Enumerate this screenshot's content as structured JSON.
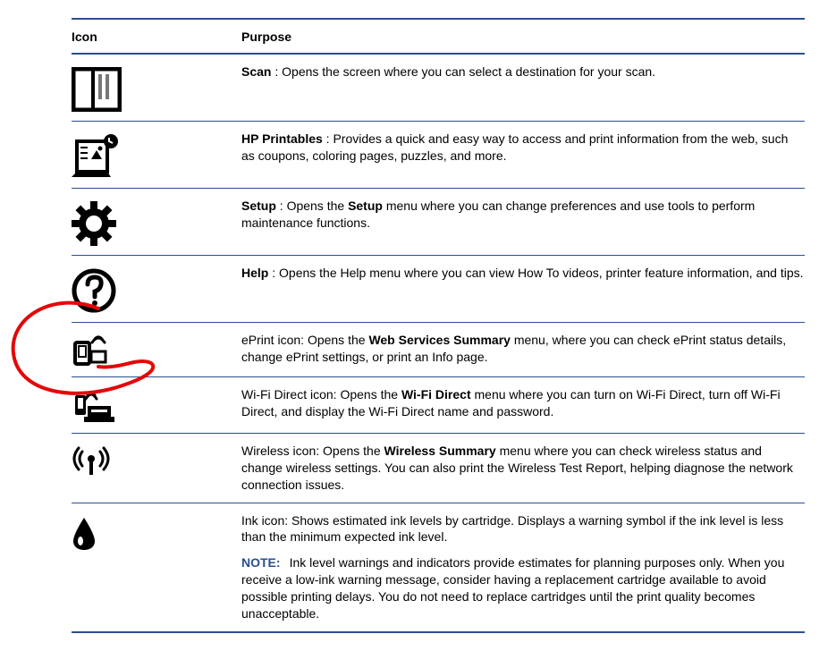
{
  "headers": {
    "icon": "Icon",
    "purpose": "Purpose"
  },
  "rows": [
    {
      "icon": "scan",
      "title": "Scan",
      "sep": " : ",
      "desc": "Opens the screen where you can select a destination for your scan."
    },
    {
      "icon": "printables",
      "title": "HP Printables",
      "sep": " : ",
      "desc": "Provides a quick and easy way to access and print information from the web, such as coupons, coloring pages, puzzles, and more."
    },
    {
      "icon": "setup",
      "title": "Setup",
      "sep": " : ",
      "pre": "Opens the ",
      "bold1": "Setup",
      "post": " menu where you can change preferences and use tools to perform maintenance functions."
    },
    {
      "icon": "help",
      "title": "Help",
      "sep": " : ",
      "desc": "Opens the Help menu where you can view How To videos, printer feature information, and tips."
    },
    {
      "icon": "eprint",
      "title_plain": "ePrint icon: ",
      "pre": "Opens the ",
      "bold1": "Web Services Summary",
      "post": " menu, where you can check ePrint status details, change ePrint settings, or print an Info page."
    },
    {
      "icon": "wifidirect",
      "title_plain": "Wi-Fi Direct icon: ",
      "pre": "Opens the ",
      "bold1": "Wi-Fi Direct",
      "post": " menu where you can turn on Wi-Fi Direct, turn off Wi-Fi Direct, and display the Wi-Fi Direct name and password."
    },
    {
      "icon": "wireless",
      "title_plain": "Wireless icon: ",
      "pre": "Opens the ",
      "bold1": "Wireless Summary",
      "post": " menu where you can check wireless status and change wireless settings. You can also print the Wireless Test Report, helping diagnose the network connection issues."
    },
    {
      "icon": "ink",
      "title_plain": "Ink icon: ",
      "desc": "Shows estimated ink levels by cartridge. Displays a warning symbol if the ink level is less than the minimum expected ink level.",
      "note_label": "NOTE:",
      "note": "Ink level warnings and indicators provide estimates for planning purposes only. When you receive a low-ink warning message, consider having a replacement cartridge available to avoid possible printing delays. You do not need to replace cartridges until the print quality becomes unacceptable."
    }
  ]
}
